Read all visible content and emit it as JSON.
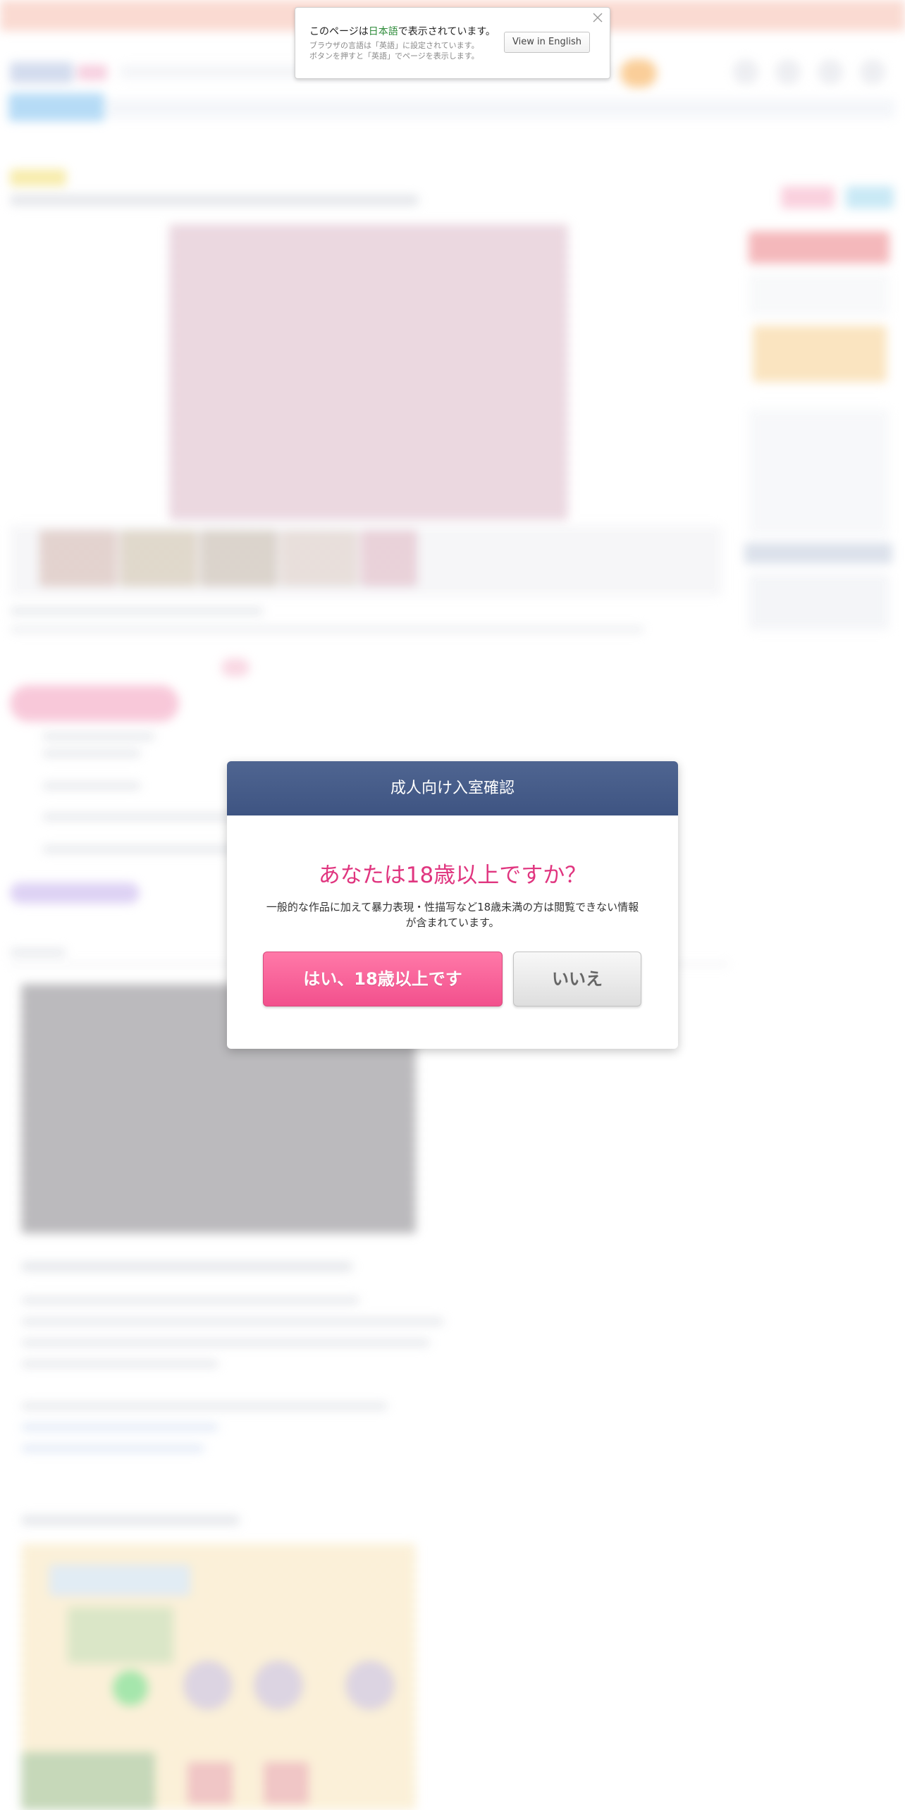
{
  "language_notice": {
    "message_before": "このページは",
    "message_highlight": "日本語",
    "message_after": "で表示されています。",
    "sub_line1": "ブラウザの言語は「英語」に設定されています。",
    "sub_line2": "ボタンを押すと「英語」でページを表示します。",
    "english_button": "View in English",
    "close_icon": "close-icon"
  },
  "age_verification": {
    "title": "成人向け入室確認",
    "question": "あなたは18歳以上ですか？",
    "note": "一般的な作品に加えて暴力表現・性描写など18歳未満の方は閲覧できない情報が含まれています。",
    "yes_button": "はい、18歳以上です",
    "no_button": "いいえ"
  },
  "colors": {
    "modal_header": "#4a5f8c",
    "question_text": "#e0357f",
    "yes_button": "#f55e96",
    "no_button": "#e6e6e6",
    "notice_highlight": "#2e8b3a"
  }
}
